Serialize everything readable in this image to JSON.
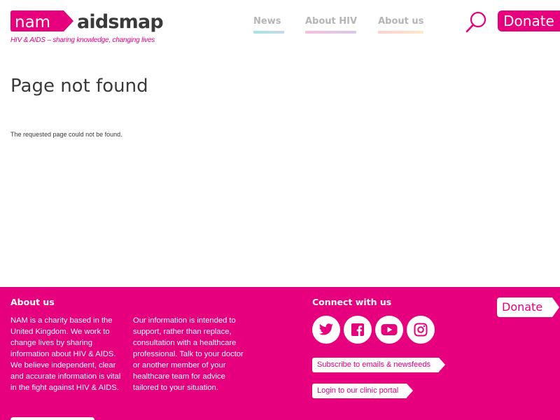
{
  "brand": {
    "logo_nam": "nam",
    "logo_site": "aidsmap",
    "tagline": "HIV & AIDS – sharing knowledge, changing lives",
    "primary_color": "#e6007e"
  },
  "nav": {
    "items": [
      {
        "label": "News"
      },
      {
        "label": "About HIV"
      },
      {
        "label": "About us"
      }
    ]
  },
  "header": {
    "search_icon": "search-icon",
    "donate_label": "Donate"
  },
  "main": {
    "title": "Page not found",
    "message": "The requested page could not be found."
  },
  "footer": {
    "about_heading": "About us",
    "about_text": "NAM is a charity based in the United Kingdom. We work to change lives by sharing information about HIV & AIDS. We believe independent, clear and accurate information is vital in the fight against HIV & AIDS.",
    "disclaimer_text": "Our information is intended to support, rather than replace, consultation with a healthcare professional. Talk to your doctor or another member of your healthcare team for advice tailored to your situation.",
    "connect_heading": "Connect with us",
    "social": [
      "twitter-icon",
      "facebook-icon",
      "youtube-icon",
      "instagram-icon"
    ],
    "subscribe_label": "Subscribe to emails & newsfeeds",
    "login_label": "Login to our clinic portal",
    "donate_label": "Donate"
  }
}
